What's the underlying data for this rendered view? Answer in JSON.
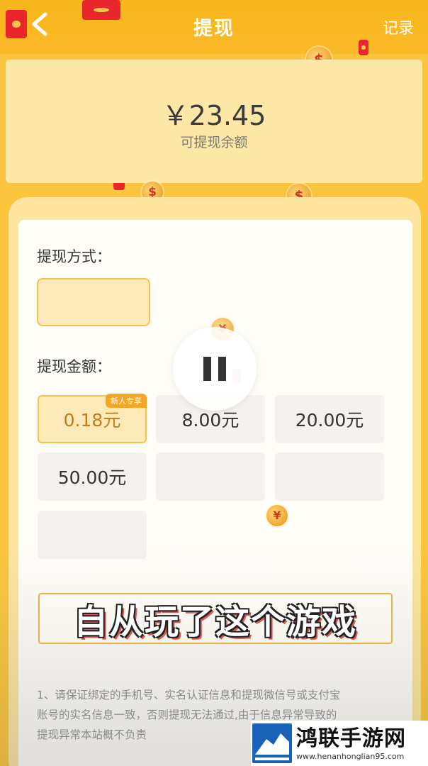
{
  "header": {
    "title": "提现",
    "record_label": "记录"
  },
  "balance": {
    "amount": "￥23.45",
    "label": "可提现余额"
  },
  "form": {
    "method_label": "提现方式：",
    "amount_label": "提现金额：",
    "options": [
      {
        "label": "0.18元",
        "selected": true,
        "tag": "新人专享"
      },
      {
        "label": "8.00元",
        "selected": false
      },
      {
        "label": "20.00元",
        "selected": false
      },
      {
        "label": "50.00元",
        "selected": false
      }
    ]
  },
  "overlay": {
    "caption": "自从玩了这个游戏"
  },
  "notice": {
    "line1": "1、请保证绑定的手机号、实名认证信息和提现微信号或支付宝",
    "line2": "账号的实名信息一致，否则提现无法通过,由于信息异常导致的",
    "line3": "提现异常本站概不负责"
  },
  "watermark": {
    "name": "鸿联手游网",
    "url": "www.henanhonglian95.com"
  },
  "colors": {
    "primary": "#fbc63d",
    "selected_border": "#f4c24a"
  }
}
